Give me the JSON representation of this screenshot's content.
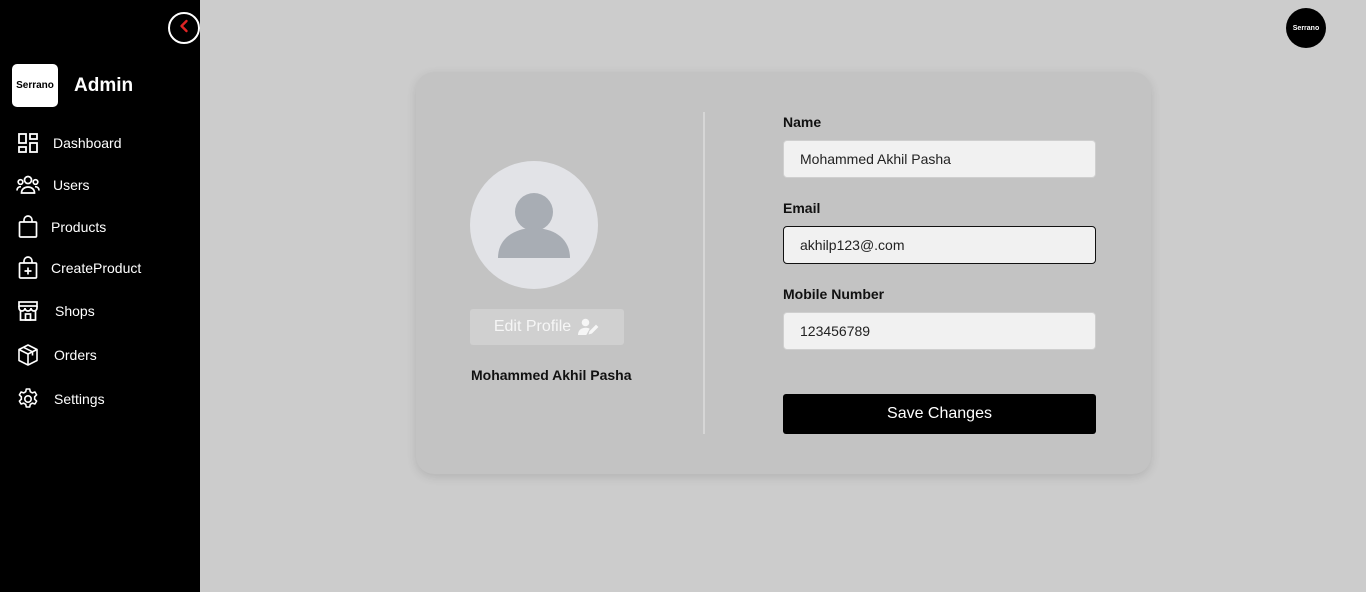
{
  "sidebar": {
    "brand_logo": "Serrano",
    "brand_title": "Admin",
    "items": [
      {
        "label": "Dashboard",
        "icon": "dashboard-icon"
      },
      {
        "label": "Users",
        "icon": "users-icon"
      },
      {
        "label": "Products",
        "icon": "shopping-bag-icon"
      },
      {
        "label": "CreateProduct",
        "icon": "bag-plus-icon"
      },
      {
        "label": "Shops",
        "icon": "store-icon"
      },
      {
        "label": "Orders",
        "icon": "package-icon"
      },
      {
        "label": "Settings",
        "icon": "gear-icon"
      }
    ]
  },
  "header": {
    "avatar_text": "Serrano"
  },
  "profile": {
    "name": "Mohammed Akhil Pasha",
    "edit_label": "Edit Profile"
  },
  "form": {
    "name_label": "Name",
    "name_value": "Mohammed Akhil Pasha",
    "email_label": "Email",
    "email_value": "akhilp123@.com",
    "mobile_label": "Mobile Number",
    "mobile_value": "123456789",
    "save_label": "Save Changes"
  },
  "colors": {
    "accent_red": "#e02424",
    "sidebar_bg": "#000000",
    "page_bg": "#cccccc"
  }
}
